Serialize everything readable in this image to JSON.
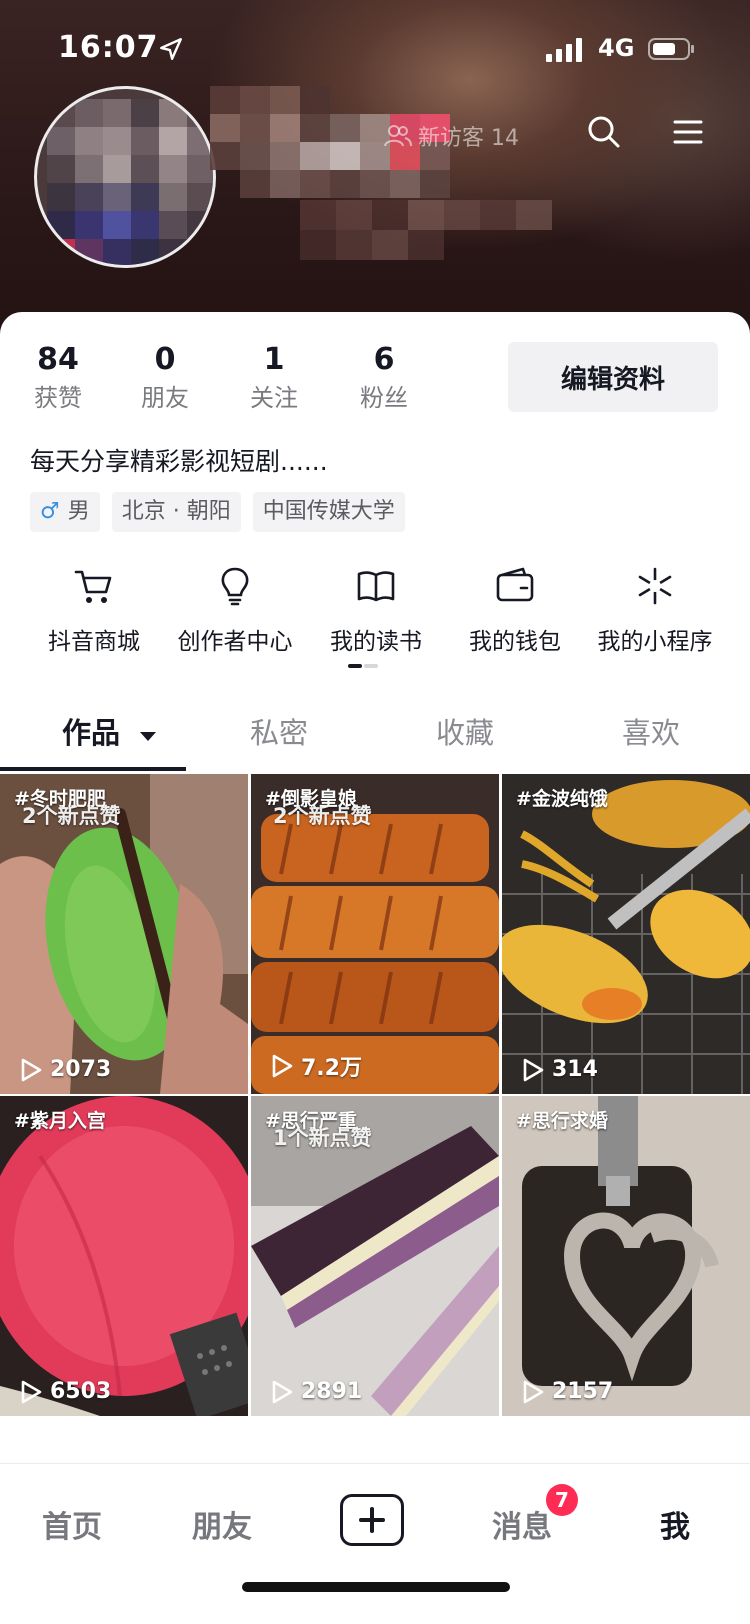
{
  "status_bar": {
    "time": "16:07",
    "network": "4G"
  },
  "header": {
    "visitors_label": "新访客 14"
  },
  "profile": {
    "stats": [
      {
        "value": "84",
        "label": "获赞"
      },
      {
        "value": "0",
        "label": "朋友"
      },
      {
        "value": "1",
        "label": "关注"
      },
      {
        "value": "6",
        "label": "粉丝"
      }
    ],
    "edit_label": "编辑资料",
    "bio": "每天分享精彩影视短剧......",
    "tags": [
      {
        "icon": "male-icon",
        "symbol": "♂",
        "label": "男"
      },
      {
        "label": "北京 · 朝阳"
      },
      {
        "label": "中国传媒大学"
      }
    ]
  },
  "shortcuts": [
    {
      "icon": "cart-icon",
      "label": "抖音商城"
    },
    {
      "icon": "bulb-icon",
      "label": "创作者中心"
    },
    {
      "icon": "book-icon",
      "label": "我的读书"
    },
    {
      "icon": "wallet-icon",
      "label": "我的钱包"
    },
    {
      "icon": "miniprogram-icon",
      "label": "我的小程序"
    }
  ],
  "tabs": [
    {
      "label": "作品",
      "active": true
    },
    {
      "label": "私密"
    },
    {
      "label": "收藏"
    },
    {
      "label": "喜欢"
    }
  ],
  "videos": [
    {
      "tag": "#冬时肥肥",
      "new_likes": "2个新点赞",
      "plays": "2073",
      "colors": [
        "#7a5a4a",
        "#6cbf4a"
      ]
    },
    {
      "tag": "#倒影皇娘",
      "new_likes": "2个新点赞",
      "plays": "7.2万",
      "colors": [
        "#7a3b16",
        "#d9782c"
      ]
    },
    {
      "tag": "#金波纯饿",
      "new_likes": "",
      "plays": "314",
      "colors": [
        "#3b3a36",
        "#e9b227"
      ]
    },
    {
      "tag": "#紫月入宫",
      "new_likes": "",
      "plays": "6503",
      "colors": [
        "#e23b5a",
        "#f26a7e"
      ]
    },
    {
      "tag": "#思行严重",
      "new_likes": "1个新点赞",
      "plays": "2891",
      "colors": [
        "#4a2e45",
        "#c9b3c7"
      ]
    },
    {
      "tag": "#思行求婚",
      "new_likes": "",
      "plays": "2157",
      "colors": [
        "#6a5a4e",
        "#d9cfc6"
      ]
    }
  ],
  "bottom_nav": [
    {
      "label": "首页"
    },
    {
      "label": "朋友"
    },
    {
      "label": "消息",
      "badge": "7"
    },
    {
      "label": "我",
      "active": true
    }
  ],
  "colors": {
    "accent": "#fe2c55",
    "text": "#161823",
    "muted": "#7a7b80"
  }
}
